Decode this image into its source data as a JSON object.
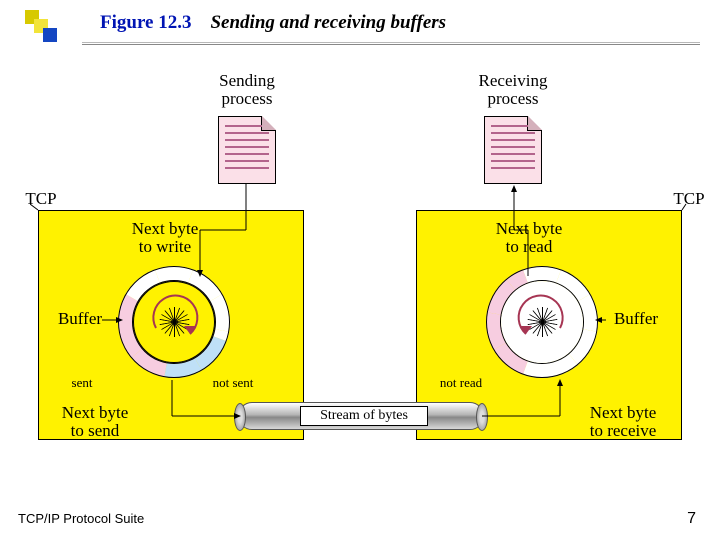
{
  "figure_number": "Figure 12.3",
  "caption": "Sending and receiving buffers",
  "footer_left": "TCP/IP Protocol Suite",
  "footer_right": "7",
  "sending_process": "Sending\nprocess",
  "receiving_process": "Receiving\nprocess",
  "tcp_left": "TCP",
  "tcp_right": "TCP",
  "next_byte_to_write": "Next byte\nto write",
  "next_byte_to_read": "Next byte\nto read",
  "buffer_left": "Buffer",
  "buffer_right": "Buffer",
  "sent": "sent",
  "not_sent": "not sent",
  "not_read": "not read",
  "next_byte_to_send": "Next byte\nto send",
  "next_byte_to_receive": "Next byte\nto receive",
  "stream_label": "Stream of bytes",
  "diagram": {
    "left_ring_segments": [
      {
        "color": "#bfe0f7",
        "start": 110,
        "end": 150
      },
      {
        "color": "#bfe0f7",
        "start": 150,
        "end": 190
      },
      {
        "color": "#f7cde0",
        "start": 190,
        "end": 300
      },
      {
        "color": "#ffffff",
        "start": 300,
        "end": 470
      }
    ],
    "right_ring_segments": [
      {
        "color": "#f7cde0",
        "start": 200,
        "end": 340
      },
      {
        "color": "#ffffff",
        "start": 340,
        "end": 560
      }
    ],
    "spokes": 18,
    "arrow_color": "#a63553"
  }
}
